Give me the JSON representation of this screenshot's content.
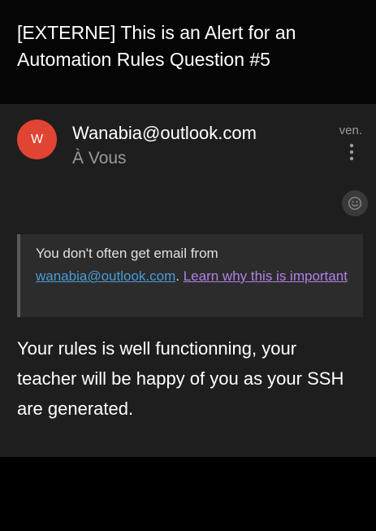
{
  "email": {
    "subject": "[EXTERNE] This is an Alert for an Automation Rules Question #5",
    "sender": {
      "avatar_letter": "W",
      "avatar_color": "#e14432",
      "address": "Wanabia@outlook.com"
    },
    "recipient": "À Vous",
    "date": "ven.",
    "more_icon": "more-vertical-icon",
    "react_icon": "smiley-icon",
    "warning": {
      "prefix": "You don't often get email from",
      "sender_link": "wanabia@outlook.com",
      "separator": ".",
      "learn_link": "Learn why this is important"
    },
    "body": "Your rules is well functionning, your teacher will be happy of you as your SSH are generated."
  }
}
